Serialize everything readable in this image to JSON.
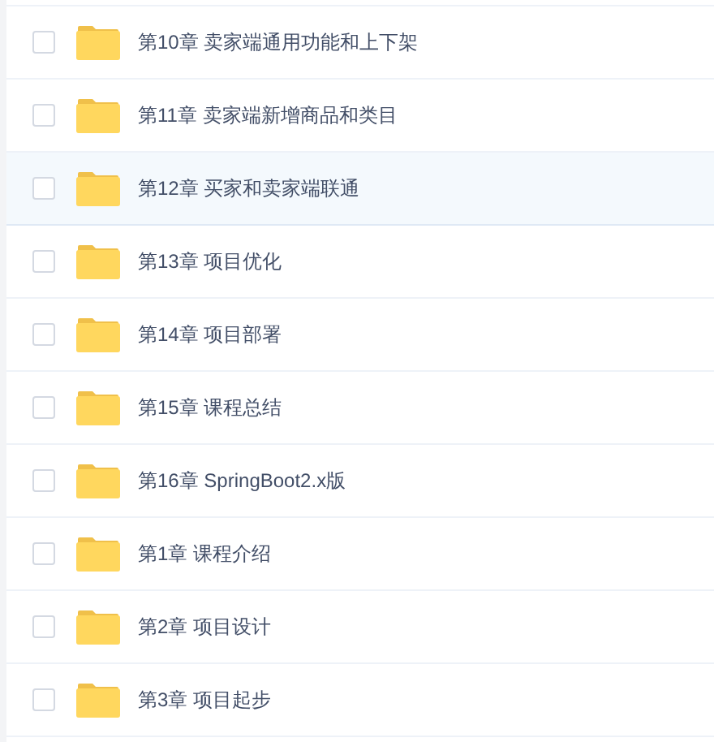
{
  "files": [
    {
      "name": "第10章 卖家端通用功能和上下架",
      "checked": false,
      "highlighted": false
    },
    {
      "name": "第11章 卖家端新增商品和类目",
      "checked": false,
      "highlighted": false
    },
    {
      "name": "第12章 买家和卖家端联通",
      "checked": false,
      "highlighted": true
    },
    {
      "name": "第13章 项目优化",
      "checked": false,
      "highlighted": false
    },
    {
      "name": "第14章 项目部署",
      "checked": false,
      "highlighted": false
    },
    {
      "name": "第15章 课程总结",
      "checked": false,
      "highlighted": false
    },
    {
      "name": "第16章 SpringBoot2.x版",
      "checked": false,
      "highlighted": false
    },
    {
      "name": "第1章 课程介绍",
      "checked": false,
      "highlighted": false
    },
    {
      "name": "第2章 项目设计",
      "checked": false,
      "highlighted": false
    },
    {
      "name": "第3章 项目起步",
      "checked": false,
      "highlighted": false
    }
  ]
}
